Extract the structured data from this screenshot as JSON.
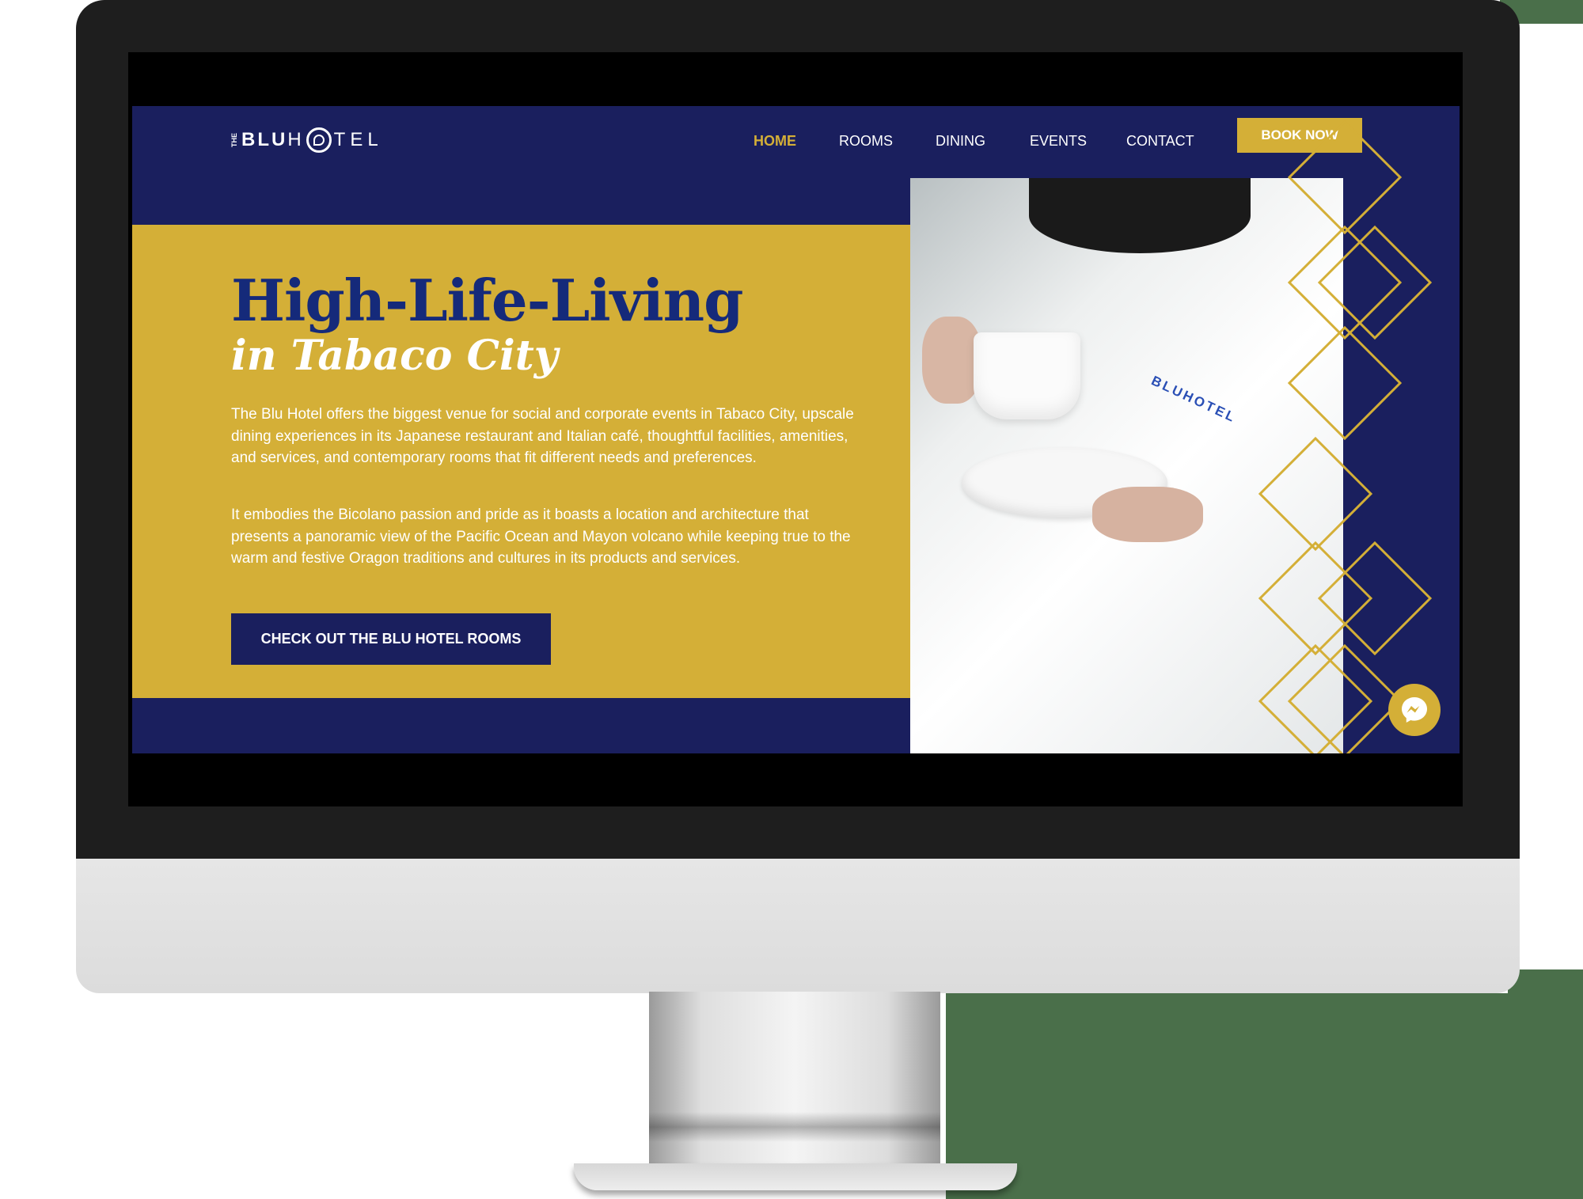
{
  "site": {
    "logo": {
      "the": "THE",
      "blu": "BLU",
      "h": "H",
      "tel": "TEL"
    },
    "nav": {
      "home": "HOME",
      "rooms": "ROOMS",
      "dining": "DINING",
      "events": "EVENTS",
      "contact": "CONTACT",
      "book_now": "BOOK NOW"
    },
    "hero": {
      "title": "High-Life-Living",
      "subtitle": "in Tabaco City",
      "paragraph_1": "The Blu Hotel offers the biggest venue for social and corporate events in Tabaco City, upscale dining experiences in its Japanese restaurant and Italian café, thoughtful facilities, amenities, and services, and contemporary rooms that fit different needs and preferences.",
      "paragraph_2": "It embodies the Bicolano passion and pride as it boasts a location and architecture that presents a panoramic view of the Pacific Ocean and Mayon volcano while keeping true to the warm and festive Oragon traditions and cultures in its products and services.",
      "cta": "CHECK OUT THE BLU HOTEL ROOMS"
    },
    "photo": {
      "robe_logo": "BLUHOTEL"
    },
    "icons": {
      "messenger": "messenger-icon"
    }
  },
  "colors": {
    "navy": "#1a1f5e",
    "gold": "#d4af37",
    "title_blue": "#152a7a"
  }
}
